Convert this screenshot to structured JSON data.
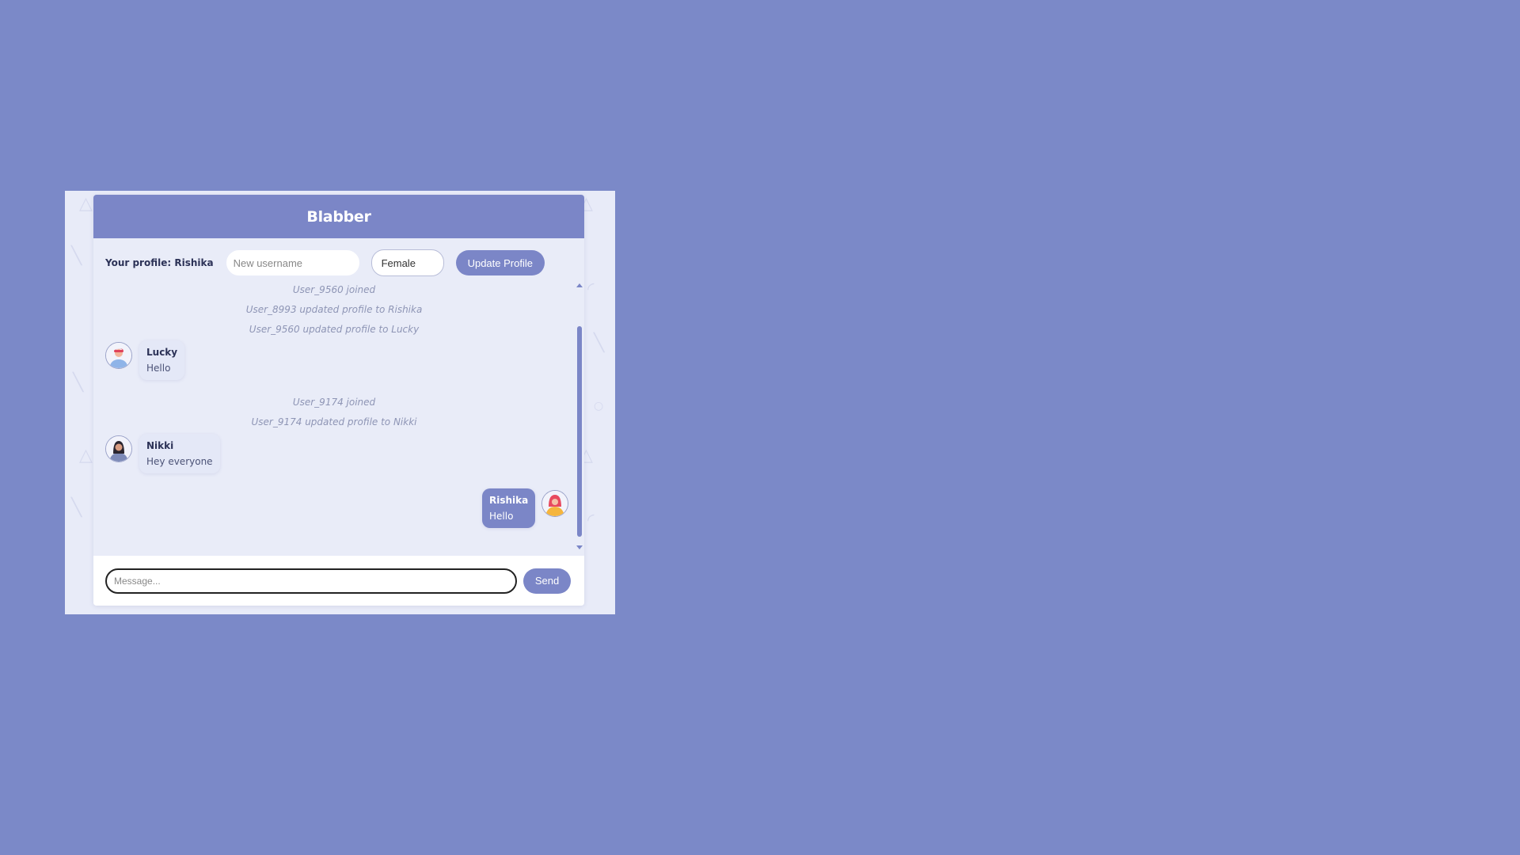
{
  "app": {
    "title": "Blabber"
  },
  "profile": {
    "label": "Your profile: Rishika",
    "username_placeholder": "New username",
    "gender_selected": "Female",
    "update_button": "Update Profile"
  },
  "messages": [
    {
      "kind": "system",
      "text": "User_9560 joined"
    },
    {
      "kind": "system",
      "text": "User_8993 updated profile to Rishika"
    },
    {
      "kind": "system",
      "text": "User_9560 updated profile to Lucky"
    },
    {
      "kind": "chat",
      "user": "Lucky",
      "text": "Hello",
      "own": false,
      "avatar_icon": "boy-cap-avatar-icon"
    },
    {
      "kind": "system",
      "text": "User_9174 joined"
    },
    {
      "kind": "system",
      "text": "User_9174 updated profile to Nikki"
    },
    {
      "kind": "chat",
      "user": "Nikki",
      "text": "Hey everyone",
      "own": false,
      "avatar_icon": "girl-avatar-icon"
    },
    {
      "kind": "chat",
      "user": "Rishika",
      "text": "Hello",
      "own": true,
      "avatar_icon": "girl-hood-avatar-icon"
    }
  ],
  "composer": {
    "placeholder": "Message...",
    "send_button": "Send"
  },
  "colors": {
    "accent": "#7b86c7",
    "background": "#7b89c8",
    "panel": "#e9ecf8"
  }
}
